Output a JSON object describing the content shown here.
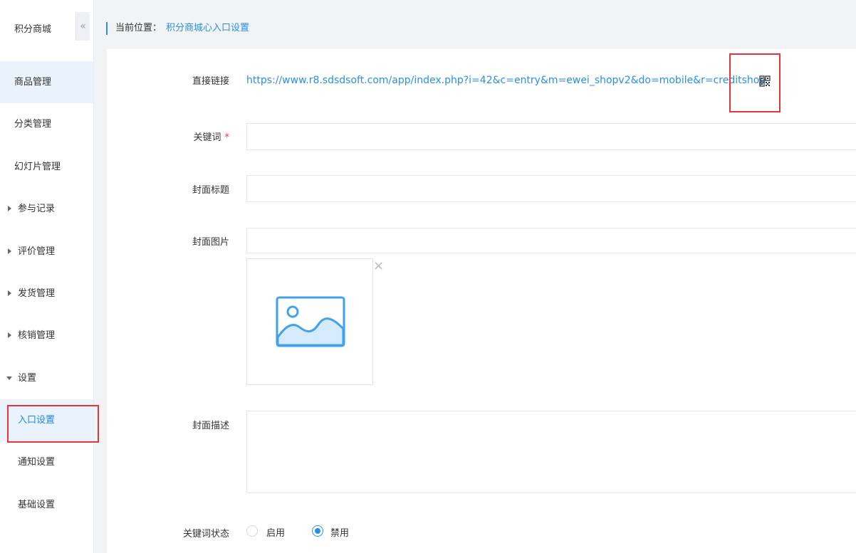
{
  "sidebar": {
    "title": "积分商城",
    "collapse_glyph": "«",
    "items": [
      {
        "label": "商品管理"
      },
      {
        "label": "分类管理"
      },
      {
        "label": "幻灯片管理"
      },
      {
        "label": "参与记录"
      },
      {
        "label": "评价管理"
      },
      {
        "label": "发货管理"
      },
      {
        "label": "核销管理"
      },
      {
        "label": "设置"
      },
      {
        "label": "入口设置"
      },
      {
        "label": "通知设置"
      },
      {
        "label": "基础设置"
      }
    ]
  },
  "breadcrumb": {
    "label": "当前位置：",
    "current": "积分商城心入口设置"
  },
  "form": {
    "link_label": "直接链接",
    "link_url": "https://www.r8.sdsdsoft.com/app/index.php?i=42&c=entry&m=ewei_shopv2&do=mobile&r=creditshop",
    "keyword_label": "关键词",
    "required_mark": "*",
    "cover_title_label": "封面标题",
    "cover_image_label": "封面图片",
    "remove_glyph": "×",
    "cover_desc_label": "封面描述",
    "keyword_status_label": "关键词状态",
    "status_options": [
      {
        "label": "启用",
        "checked": false
      },
      {
        "label": "禁用",
        "checked": true
      }
    ]
  },
  "colors": {
    "accent": "#2a8fe4",
    "highlight": "#e4363a",
    "active_bg": "#eaf3fc"
  },
  "icons": {
    "qr": "qrcode-icon",
    "image_placeholder": "image-placeholder-icon",
    "collapse": "double-chevron-left-icon"
  }
}
